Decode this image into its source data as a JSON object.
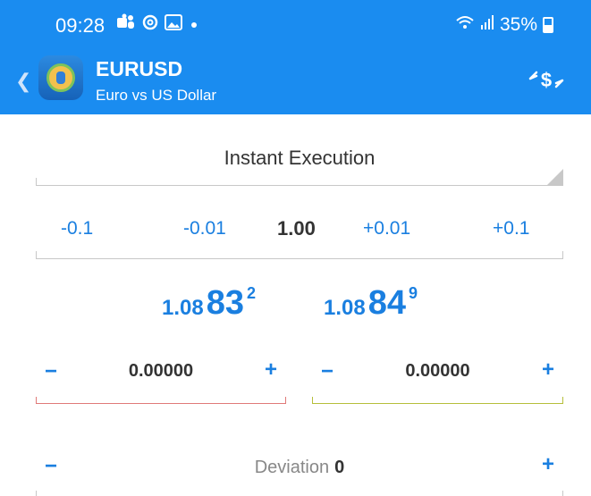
{
  "status_bar": {
    "time": "09:28",
    "battery": "35%",
    "icons": [
      "teams-icon",
      "threads-icon",
      "gallery-icon",
      "dot-icon"
    ]
  },
  "header": {
    "symbol": "EURUSD",
    "description": "Euro vs US Dollar",
    "back_icon": "chevron-left-icon",
    "action_icon": "currency-exchange-icon"
  },
  "order_type": {
    "label": "Instant Execution"
  },
  "volume": {
    "minus_large": "-0.1",
    "minus_small": "-0.01",
    "value": "1.00",
    "plus_small": "+0.01",
    "plus_large": "+0.1"
  },
  "prices": {
    "bid": {
      "prefix": "1.08",
      "main": "83",
      "fraction": "2"
    },
    "ask": {
      "prefix": "1.08",
      "main": "84",
      "fraction": "9"
    }
  },
  "stop_loss": {
    "value": "0.00000",
    "minus": "−",
    "plus": "+"
  },
  "take_profit": {
    "value": "0.00000",
    "minus": "−",
    "plus": "+"
  },
  "deviation": {
    "label": "Deviation",
    "value": "0",
    "minus": "−",
    "plus": "+"
  },
  "colors": {
    "header_bg": "#1a8cf0",
    "accent": "#1a7fe0",
    "stop_loss_line": "#e07a78",
    "take_profit_line": "#b6bf3a"
  }
}
